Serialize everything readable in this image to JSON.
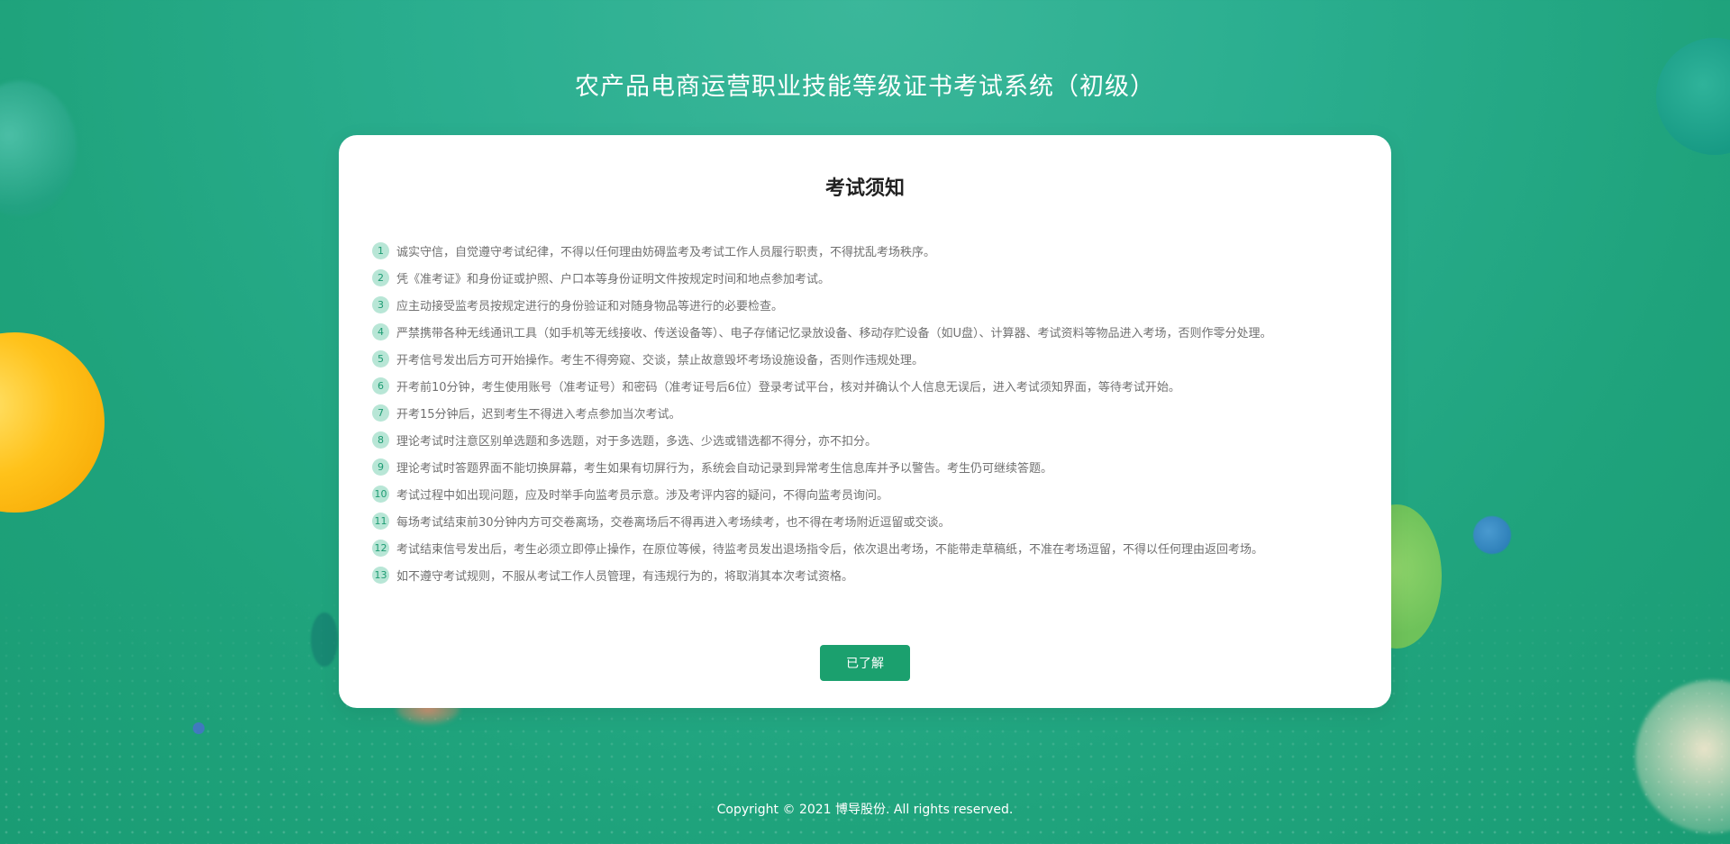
{
  "header": {
    "title": "农产品电商运营职业技能等级证书考试系统（初级）"
  },
  "notice": {
    "title": "考试须知",
    "rules": [
      {
        "num": "1",
        "text": "诚实守信，自觉遵守考试纪律，不得以任何理由妨碍监考及考试工作人员履行职责，不得扰乱考场秩序。"
      },
      {
        "num": "2",
        "text": "凭《准考证》和身份证或护照、户口本等身份证明文件按规定时间和地点参加考试。"
      },
      {
        "num": "3",
        "text": "应主动接受监考员按规定进行的身份验证和对随身物品等进行的必要检查。"
      },
      {
        "num": "4",
        "text": "严禁携带各种无线通讯工具（如手机等无线接收、传送设备等）、电子存储记忆录放设备、移动存贮设备（如U盘）、计算器、考试资料等物品进入考场，否则作零分处理。"
      },
      {
        "num": "5",
        "text": "开考信号发出后方可开始操作。考生不得旁窥、交谈，禁止故意毁坏考场设施设备，否则作违规处理。"
      },
      {
        "num": "6",
        "text": "开考前10分钟，考生使用账号（准考证号）和密码（准考证号后6位）登录考试平台，核对并确认个人信息无误后，进入考试须知界面，等待考试开始。"
      },
      {
        "num": "7",
        "text": "开考15分钟后，迟到考生不得进入考点参加当次考试。"
      },
      {
        "num": "8",
        "text": "理论考试时注意区别单选题和多选题，对于多选题，多选、少选或错选都不得分，亦不扣分。"
      },
      {
        "num": "9",
        "text": "理论考试时答题界面不能切换屏幕，考生如果有切屏行为，系统会自动记录到异常考生信息库并予以警告。考生仍可继续答题。"
      },
      {
        "num": "10",
        "text": "考试过程中如出现问题，应及时举手向监考员示意。涉及考评内容的疑问，不得向监考员询问。"
      },
      {
        "num": "11",
        "text": "每场考试结束前30分钟内方可交卷离场，交卷离场后不得再进入考场续考，也不得在考场附近逗留或交谈。"
      },
      {
        "num": "12",
        "text": "考试结束信号发出后，考生必须立即停止操作，在原位等候，待监考员发出退场指令后，依次退出考场，不能带走草稿纸，不准在考场逗留，不得以任何理由返回考场。"
      },
      {
        "num": "13",
        "text": "如不遵守考试规则，不服从考试工作人员管理，有违规行为的，将取消其本次考试资格。"
      }
    ],
    "confirm_label": "已了解"
  },
  "footer": {
    "copyright": "Copyright © 2021 博导股份. All rights reserved."
  },
  "colors": {
    "background": "#22a886",
    "accent": "#1ba06e",
    "number_badge": "#b8e6d6",
    "rule_text": "#707070"
  }
}
